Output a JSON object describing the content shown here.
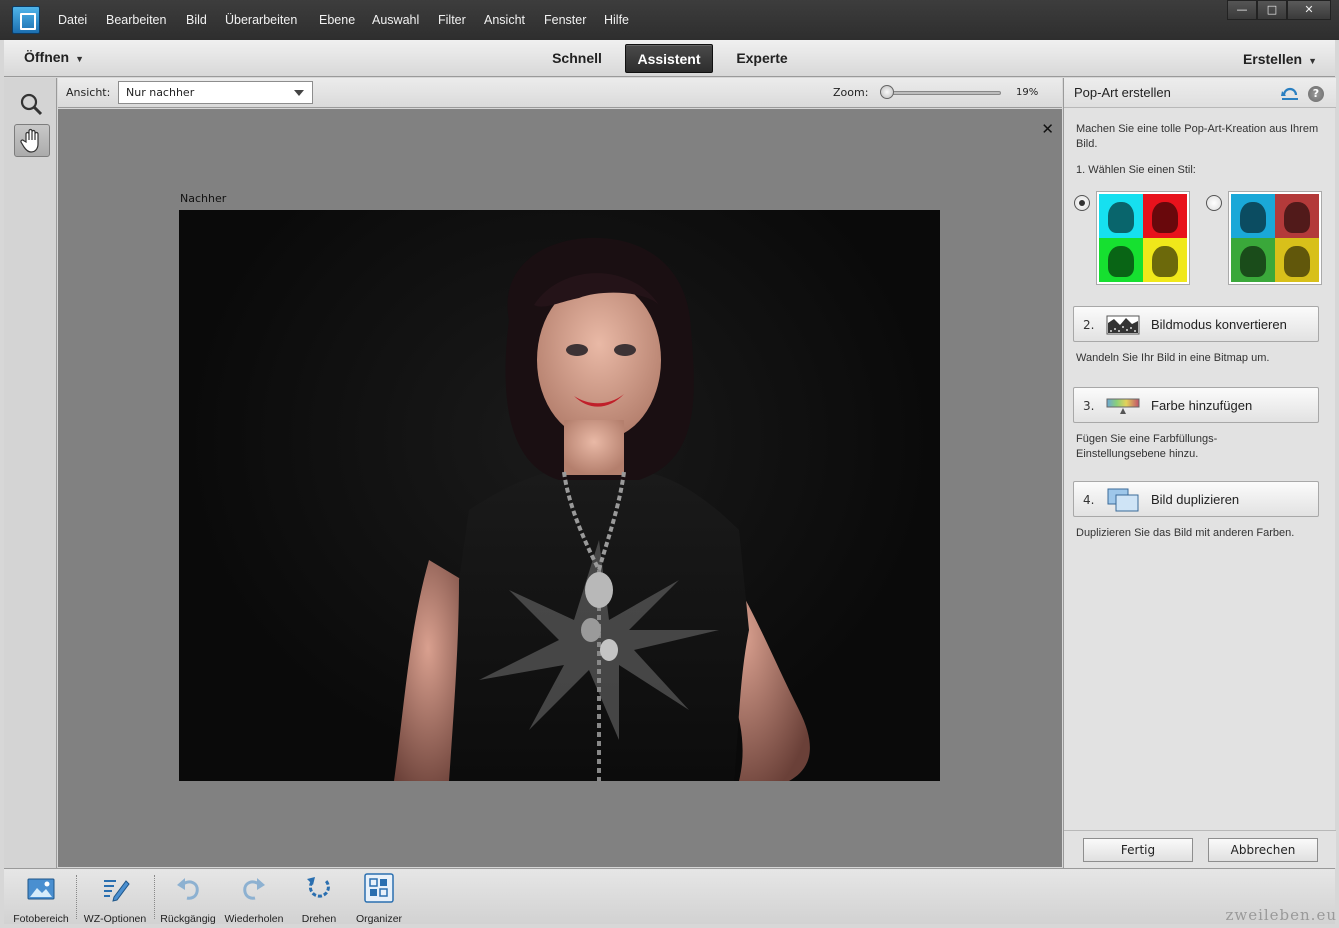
{
  "menubar": {
    "items": [
      "Datei",
      "Bearbeiten",
      "Bild",
      "Überarbeiten",
      "Ebene",
      "Auswahl",
      "Filter",
      "Ansicht",
      "Fenster",
      "Hilfe"
    ],
    "mnemonics": [
      "D",
      "B",
      "B",
      "Ü",
      "E",
      "A",
      "F",
      "A",
      "s",
      "H"
    ],
    "window_controls": {
      "minimize": "—",
      "maximize": "□",
      "close": "✕"
    }
  },
  "modebar": {
    "open_label": "Öffnen",
    "create_label": "Erstellen",
    "tabs": [
      {
        "label": "Schnell",
        "active": false
      },
      {
        "label": "Assistent",
        "active": true
      },
      {
        "label": "Experte",
        "active": false
      }
    ]
  },
  "options": {
    "view_label": "Ansicht:",
    "view_value": "Nur nachher",
    "zoom_label": "Zoom:",
    "zoom_value": "19%",
    "zoom_level": 0.02
  },
  "canvas": {
    "after_label": "Nachher",
    "close_glyph": "✕",
    "bg_color": "#818181"
  },
  "panel": {
    "title": "Pop-Art erstellen",
    "intro": "Machen Sie eine tolle Pop-Art-Kreation aus Ihrem Bild.",
    "step1": "1. Wählen Sie einen Stil:",
    "styles": [
      {
        "selected": true,
        "colors": [
          "#16e0f0",
          "#e8121c",
          "#16e030",
          "#f0e81a"
        ]
      },
      {
        "selected": false,
        "colors": [
          "#1aa8d8",
          "#b33a3a",
          "#3aa83a",
          "#d8c01a"
        ]
      }
    ],
    "steps": [
      {
        "num": "2.",
        "label": "Bildmodus konvertieren",
        "desc": "Wandeln Sie Ihr Bild in eine Bitmap um.",
        "icon": "bitmap-icon"
      },
      {
        "num": "3.",
        "label": "Farbe hinzufügen",
        "desc": "Fügen Sie eine Farbfüllungs-Einstellungsebene hinzu.",
        "icon": "gradient-fill-icon"
      },
      {
        "num": "4.",
        "label": "Bild duplizieren",
        "desc": "Duplizieren Sie das Bild mit anderen Farben.",
        "icon": "duplicate-icon"
      }
    ],
    "done_label": "Fertig",
    "cancel_label": "Abbrechen",
    "help_glyph": "?"
  },
  "bottombar": {
    "items": [
      {
        "label": "Fotobereich",
        "icon": "photo-bin-icon"
      },
      {
        "label": "WZ-Optionen",
        "icon": "tool-options-icon"
      },
      {
        "label": "Rückgängig",
        "icon": "undo-icon"
      },
      {
        "label": "Wiederholen",
        "icon": "redo-icon"
      },
      {
        "label": "Drehen",
        "icon": "rotate-icon"
      },
      {
        "label": "Organizer",
        "icon": "organizer-icon"
      }
    ]
  },
  "watermark": "zweileben.eu",
  "colors": {
    "accent": "#2a7fc1",
    "dark_bar": "#333333"
  }
}
